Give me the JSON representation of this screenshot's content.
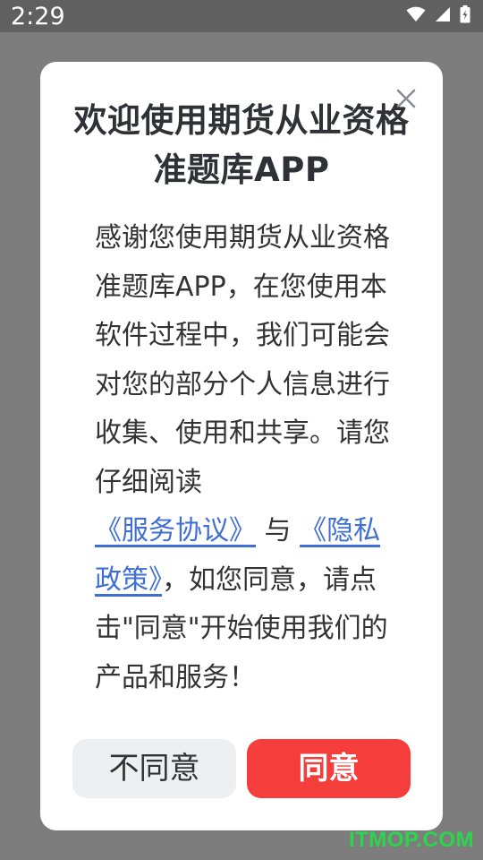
{
  "status_bar": {
    "time": "2:29",
    "icons": [
      "wifi-icon",
      "cellular-signal-icon",
      "battery-icon"
    ]
  },
  "dialog": {
    "title": "欢迎使用期货从业资格准题库APP",
    "body": {
      "intro": "感谢您使用期货从业资格准题库APP，在您使用本软件过程中，我们可能会对您的部分个人信息进行收集、使用和共享。请您仔细阅读",
      "service_link": "《服务协议》",
      "joiner": "与",
      "privacy_link": "《隐私政策》",
      "outro": "，如您同意，请点击\"同意\"开始使用我们的产品和服务！"
    },
    "buttons": {
      "disagree": "不同意",
      "agree": "同意"
    }
  },
  "watermark": "ITMOP.COM",
  "colors": {
    "agree_button": "#f53e3b",
    "link": "#3f6fd4",
    "overlay": "#7d7d7d",
    "watermark": "#2bd64b"
  }
}
